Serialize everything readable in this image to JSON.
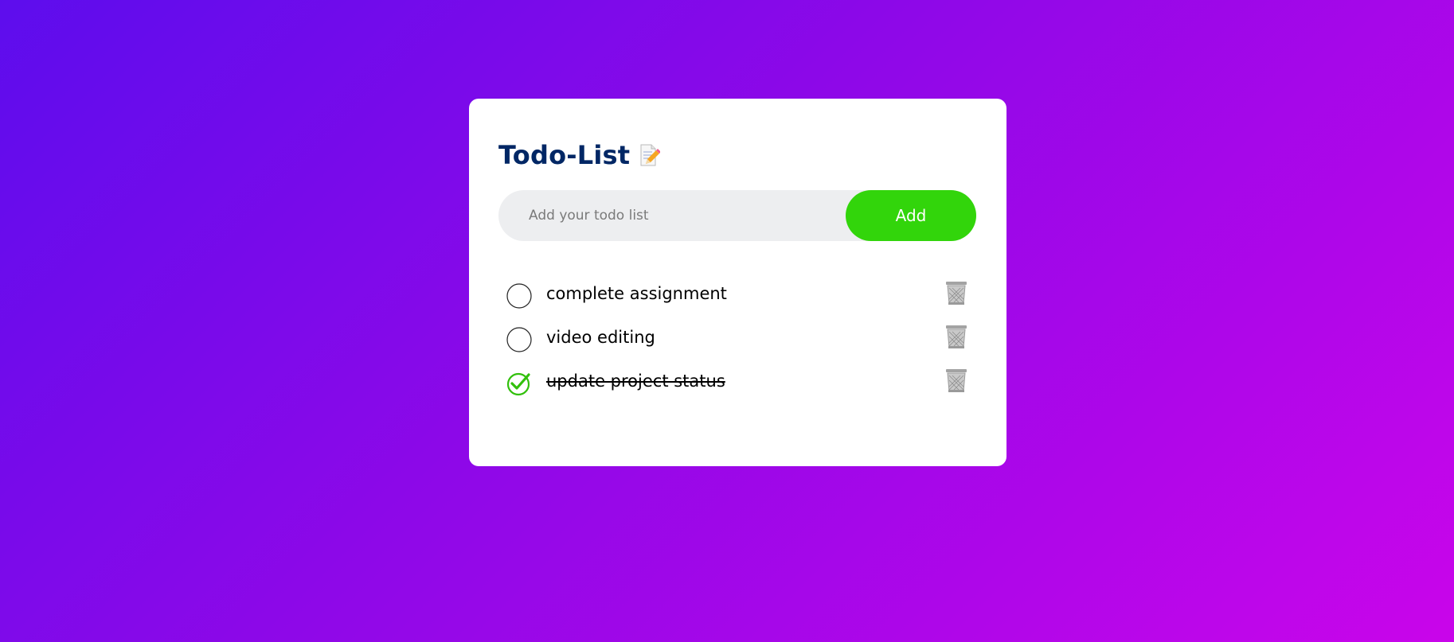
{
  "header": {
    "title": "Todo-List",
    "title_icon": "memo-icon"
  },
  "input": {
    "placeholder": "Add your todo list",
    "value": ""
  },
  "add_button": {
    "label": "Add"
  },
  "todos": [
    {
      "text": "complete assignment",
      "checked": false
    },
    {
      "text": "video editing",
      "checked": false
    },
    {
      "text": "update project status",
      "checked": true
    }
  ],
  "icons": {
    "unchecked": "circle-outline-icon",
    "checked": "check-circle-icon",
    "delete": "trash-icon"
  },
  "colors": {
    "background_start": "#5d0ded",
    "background_end": "#c905ea",
    "title": "#002765",
    "accent": "#32d50b",
    "input_bg": "#edeef0"
  }
}
